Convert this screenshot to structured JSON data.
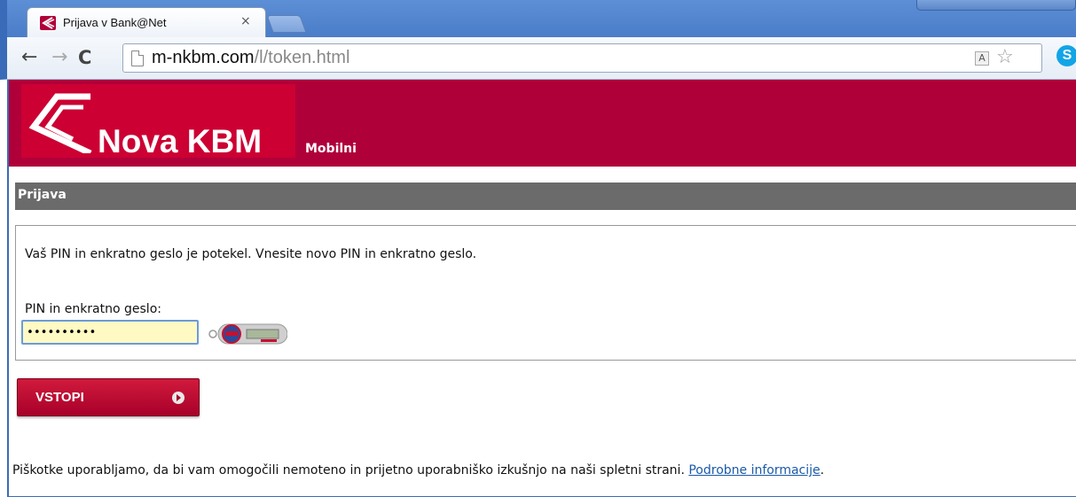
{
  "browser": {
    "tab_title": "Prijava v Bank@Net",
    "tab_close": "×",
    "url_host": "m-nkbm.com",
    "url_path": "/l/token.html",
    "back": "←",
    "forward": "→",
    "reload": "C",
    "star": "☆",
    "translate": "A",
    "skype": "S"
  },
  "header": {
    "logo_text": "Nova KBM",
    "subtitle": "Mobilni"
  },
  "section": {
    "title": "Prijava"
  },
  "form": {
    "message": "Vaš PIN in enkratno geslo je potekel. Vnesite novo PIN in enkratno geslo.",
    "pin_label": "PIN in enkratno geslo:",
    "pin_value": "••••••••••",
    "submit_label": "VSTOPI"
  },
  "footer": {
    "cookie_text": "Piškotke uporabljamo, da bi vam omogočili nemoteno in prijetno uporabniško izkušnjo na naši spletni strani. ",
    "cookie_link": "Podrobne informacije",
    "cookie_end": "."
  },
  "colors": {
    "brand": "#b0003a",
    "section_bar": "#6b6b6b",
    "input_bg": "#fff9c4"
  }
}
